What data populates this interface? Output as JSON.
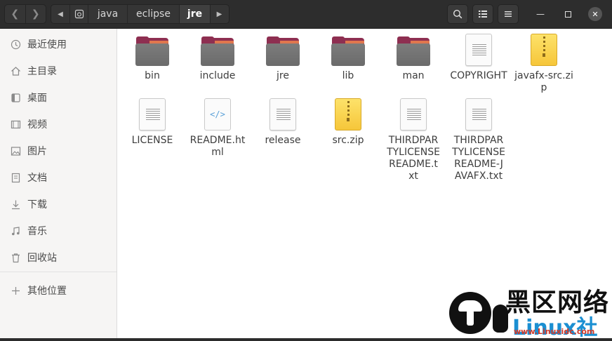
{
  "header": {
    "path": [
      "java",
      "eclipse",
      "jre"
    ],
    "active_index": 2,
    "icons": {
      "back": "chevron-left-icon",
      "forward": "chevron-right-icon",
      "path_left": "arrow-left-icon",
      "path_right": "arrow-right-icon",
      "home": "disk-icon",
      "search": "search-icon",
      "view": "list-view-icon",
      "menu": "hamburger-menu-icon",
      "minimize": "minimize-icon",
      "maximize": "maximize-icon",
      "close": "close-icon"
    }
  },
  "sidebar": {
    "items": [
      {
        "label": "最近使用",
        "icon": "clock-icon"
      },
      {
        "label": "主目录",
        "icon": "home-icon"
      },
      {
        "label": "桌面",
        "icon": "desktop-icon"
      },
      {
        "label": "视频",
        "icon": "video-icon"
      },
      {
        "label": "图片",
        "icon": "image-icon"
      },
      {
        "label": "文档",
        "icon": "document-icon"
      },
      {
        "label": "下载",
        "icon": "download-icon"
      },
      {
        "label": "音乐",
        "icon": "music-icon"
      },
      {
        "label": "回收站",
        "icon": "trash-icon"
      },
      {
        "label": "其他位置",
        "icon": "plus-icon"
      }
    ]
  },
  "files": [
    {
      "name": "bin",
      "type": "folder"
    },
    {
      "name": "include",
      "type": "folder"
    },
    {
      "name": "jre",
      "type": "folder"
    },
    {
      "name": "lib",
      "type": "folder"
    },
    {
      "name": "man",
      "type": "folder"
    },
    {
      "name": "COPYRIGHT",
      "type": "text"
    },
    {
      "name": "javafx-src.zip",
      "type": "zip"
    },
    {
      "name": "LICENSE",
      "type": "text"
    },
    {
      "name": "README.html",
      "type": "html"
    },
    {
      "name": "release",
      "type": "text"
    },
    {
      "name": "src.zip",
      "type": "zip"
    },
    {
      "name": "THIRDPARTYLICENSEREADME.txt",
      "type": "text"
    },
    {
      "name": "THIRDPARTYLICENSEREADME-JAVAFX.txt",
      "type": "text"
    }
  ],
  "watermark": {
    "big": "黑区网络",
    "brand": "Linux社",
    "url": "www.Linuxidc.com"
  },
  "colors": {
    "folder_accent": "#8e2f51",
    "folder_stripe": "#e0774e",
    "zip_yellow": "#f6c63a",
    "header_bg": "#2d2d2d"
  }
}
